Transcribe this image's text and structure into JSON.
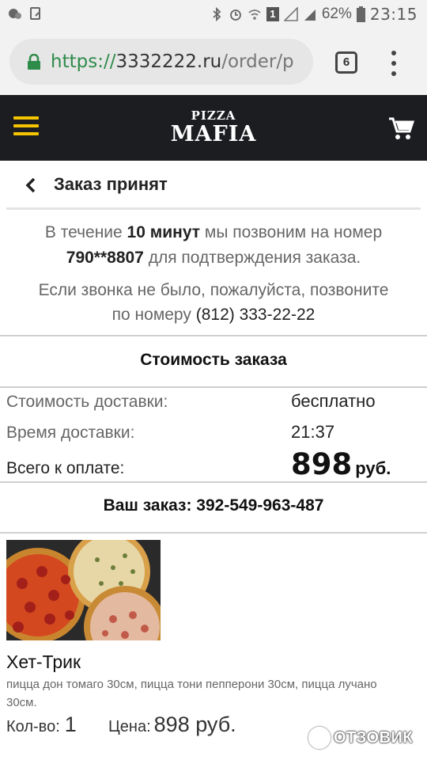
{
  "status_bar": {
    "battery_percent": "62%",
    "time": "23:15",
    "sim_slot": "1"
  },
  "browser": {
    "url_protocol": "https://",
    "url_host": "3332222.ru",
    "url_path": "/order/p",
    "tab_count": "6"
  },
  "site_header": {
    "logo_small": "PIZZA",
    "logo_big": "MAFIA",
    "accent_color": "#f5c400",
    "header_bg": "#1c1d21"
  },
  "page": {
    "title": "Заказ принят",
    "info_line1_pre": "В течение ",
    "info_line1_bold": "10 минут",
    "info_line1_post": " мы позвоним на номер",
    "info_phone_masked": "790**8807",
    "info_line2_post": " для подтверждения заказа.",
    "info_call_text": "Если звонка не было, пожалуйста, позвоните",
    "info_call_text2": "по номеру ",
    "support_phone": "(812) 333-22-22"
  },
  "cost": {
    "title": "Стоимость заказа",
    "delivery_cost_label": "Стоимость доставки:",
    "delivery_cost_value": "бесплатно",
    "delivery_time_label": "Время доставки:",
    "delivery_time_value": "21:37",
    "total_label": "Всего к оплате:",
    "total_value": "898",
    "currency": "руб."
  },
  "order": {
    "number_label": "Ваш заказ: 392-549-963-487",
    "items": [
      {
        "name": "Хет-Трик",
        "description": "пицца дон томаго 30см, пицца тони пепперони 30см, пицца лучано 30см.",
        "qty_label": "Кол-во:",
        "qty": "1",
        "price_label": "Цена:",
        "price": "898 руб."
      }
    ]
  },
  "watermark": "ОТЗОВИК"
}
